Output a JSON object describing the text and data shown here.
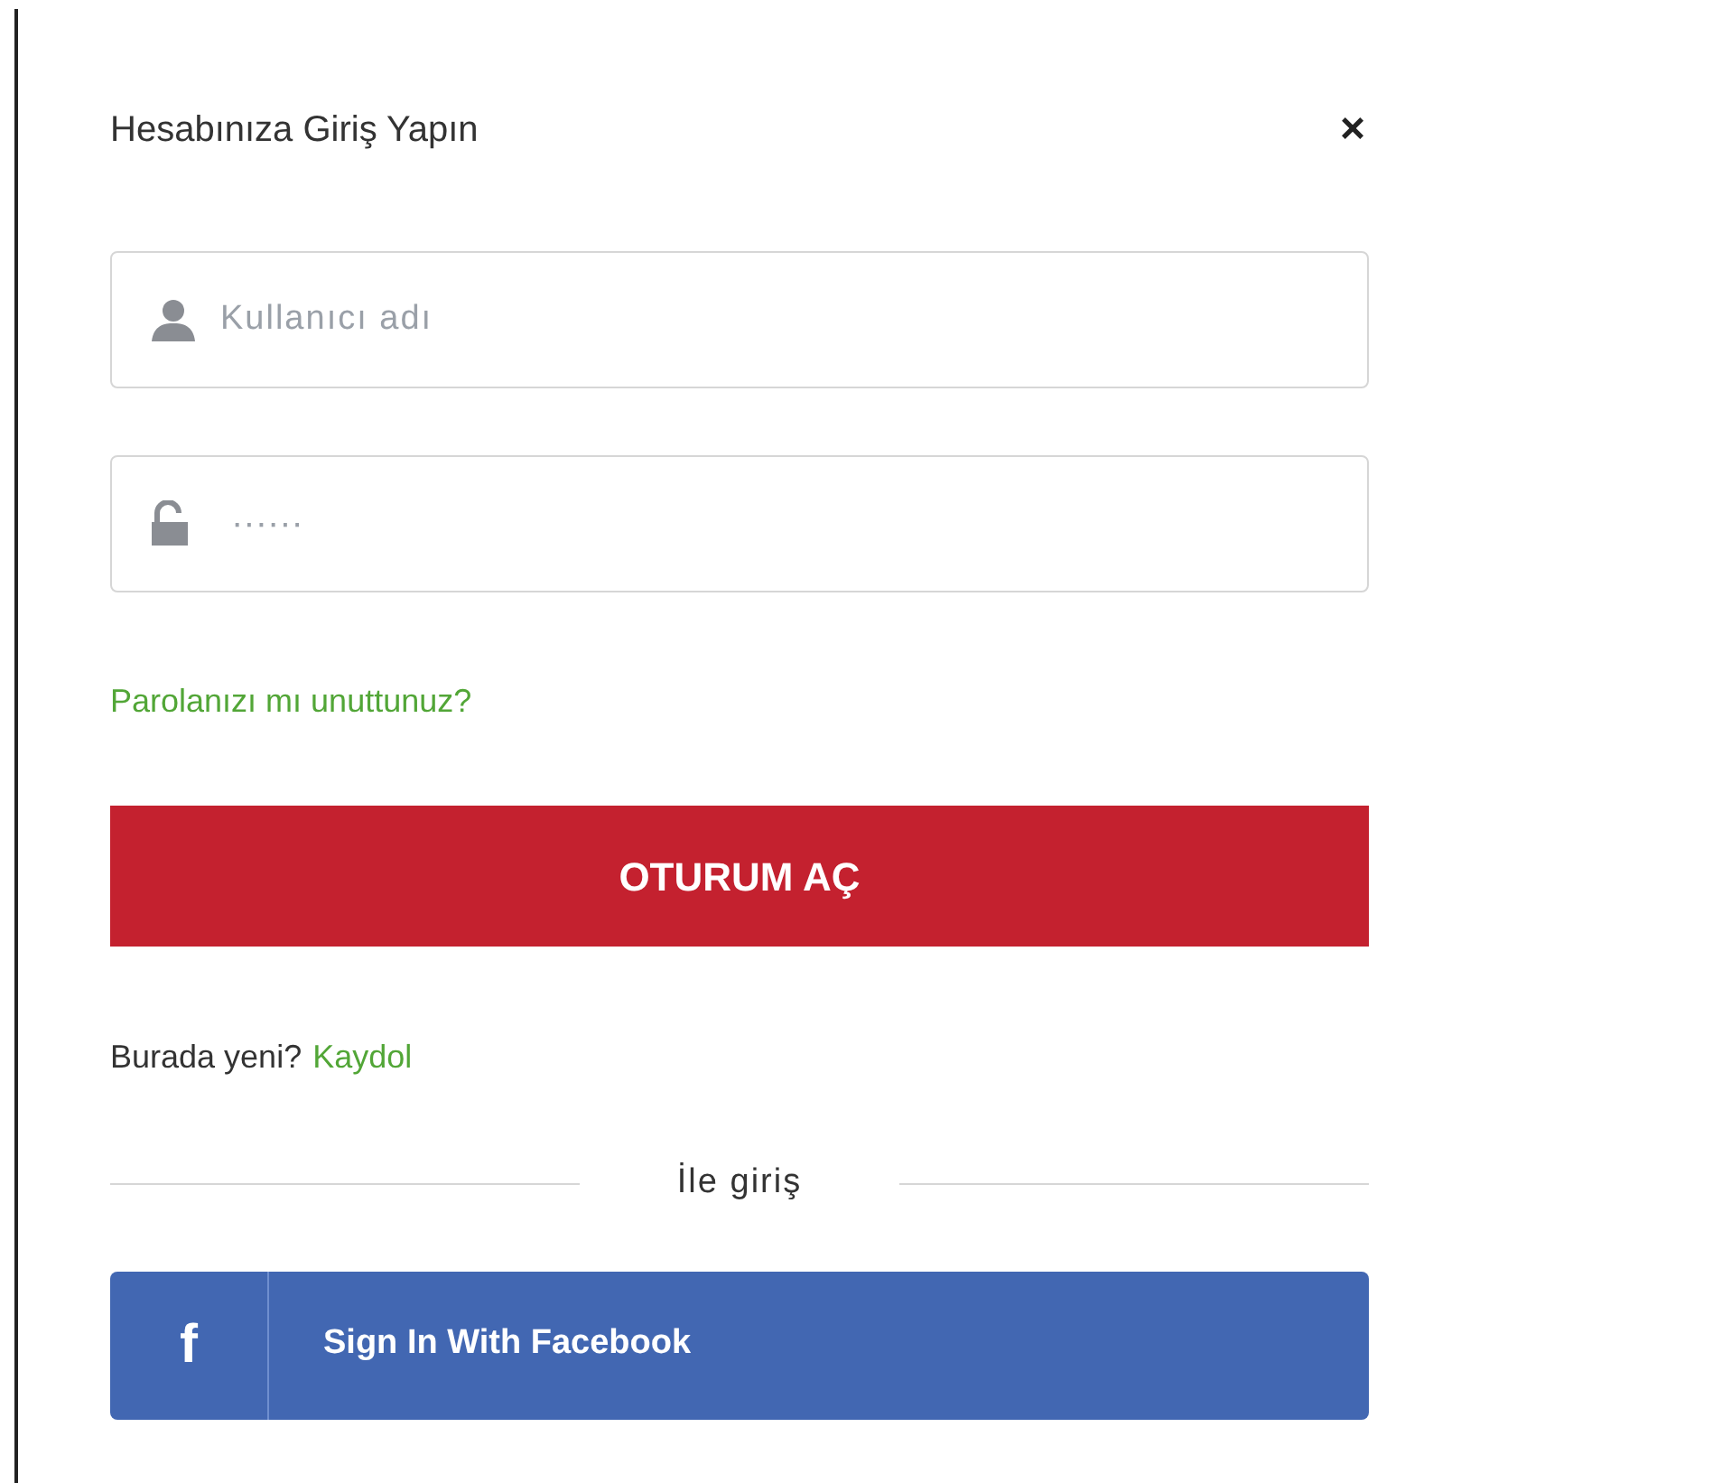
{
  "dialog": {
    "title": "Hesabınıza Giriş Yapın",
    "close": "×"
  },
  "username": {
    "placeholder": "Kullanıcı adı"
  },
  "password": {
    "placeholder": "······"
  },
  "forgot_link": "Parolanızı mı unuttunuz?",
  "submit_button": "OTURUM AÇ",
  "signup": {
    "prompt": "Burada yeni?",
    "link": "Kaydol"
  },
  "divider_label": "İle giriş",
  "facebook_button": {
    "icon": "f",
    "label": "Sign In With Facebook"
  }
}
